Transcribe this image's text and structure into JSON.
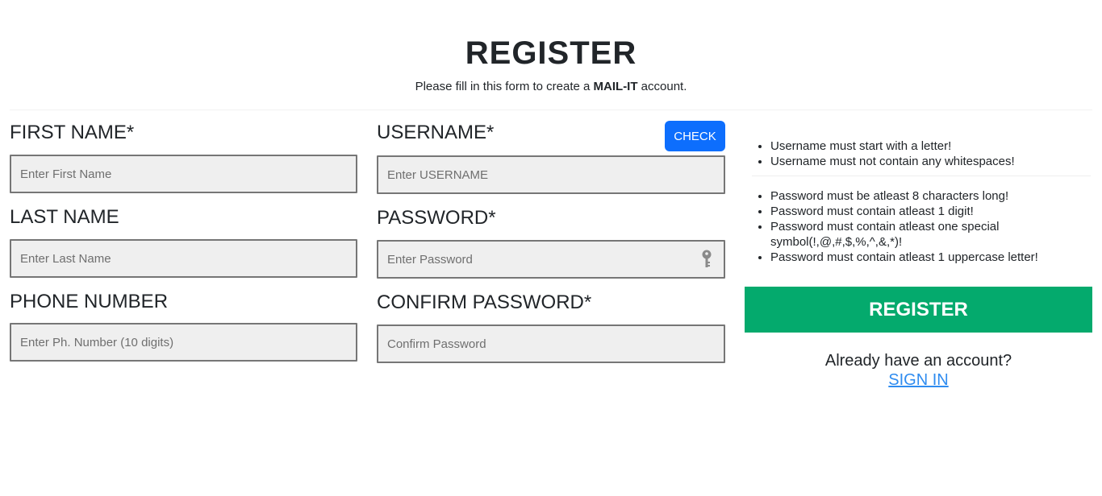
{
  "header": {
    "title": "REGISTER",
    "subtitle_before": "Please fill in this form to create a ",
    "subtitle_brand": "MAIL-IT",
    "subtitle_after": " account."
  },
  "form": {
    "first_name": {
      "label": "FIRST NAME*",
      "placeholder": "Enter First Name",
      "value": ""
    },
    "last_name": {
      "label": "LAST NAME",
      "placeholder": "Enter Last Name",
      "value": ""
    },
    "phone": {
      "label": "PHONE NUMBER",
      "placeholder": "Enter Ph. Number (10 digits)",
      "value": ""
    },
    "username": {
      "label": "USERNAME*",
      "placeholder": "Enter USERNAME",
      "value": ""
    },
    "password": {
      "label": "PASSWORD*",
      "placeholder": "Enter Password",
      "value": "",
      "icon": "key-icon"
    },
    "confirm_password": {
      "label": "CONFIRM PASSWORD*",
      "placeholder": "Confirm Password",
      "value": ""
    },
    "check_label": "CHECK"
  },
  "rules": {
    "username": [
      "Username must start with a letter!",
      "Username must not contain any whitespaces!"
    ],
    "password": [
      "Password must be atleast 8 characters long!",
      "Password must contain atleast 1 digit!",
      "Password must contain atleast one special symbol(!,@,#,$,%,^,&,*)!",
      "Password must contain atleast 1 uppercase letter!"
    ]
  },
  "actions": {
    "register_label": "REGISTER",
    "have_account_text": "Already have an account?",
    "signin_label": "SIGN IN"
  },
  "colors": {
    "check_button": "#0d6efd",
    "register_button": "#04aa6d",
    "link": "#2f8cf0",
    "input_bg": "#efefef",
    "input_border": "#767676"
  }
}
